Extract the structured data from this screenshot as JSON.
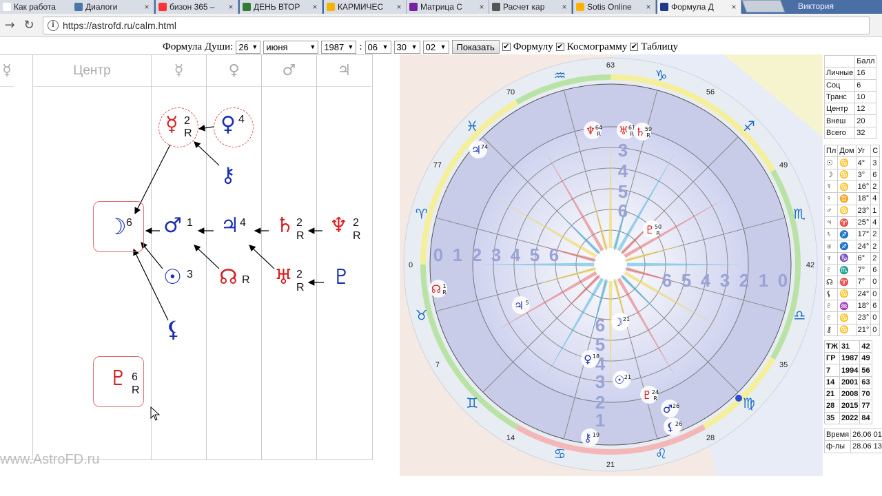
{
  "browser": {
    "tabs": [
      {
        "label": "Как работа",
        "icon": "page-icon",
        "color": "#ffffff"
      },
      {
        "label": "Диалоги",
        "icon": "vk-icon",
        "color": "#4a76a8"
      },
      {
        "label": "бизон 365 –",
        "icon": "yandex-icon",
        "color": "#ff3333"
      },
      {
        "label": "ДЕНЬ ВТОР",
        "icon": "ring-icon",
        "color": "#2e7d32"
      },
      {
        "label": "КАРМИЧЕС",
        "icon": "drive-icon",
        "color": "#f4b400"
      },
      {
        "label": "Матрица С",
        "icon": "gear-icon",
        "color": "#7b1fa2"
      },
      {
        "label": "Расчет кар",
        "icon": "search-icon",
        "color": "#555555"
      },
      {
        "label": "Sotis Online",
        "icon": "sotis-icon",
        "color": "#ffb300"
      },
      {
        "label": "Формула Д",
        "icon": "astro-icon",
        "color": "#1e3a8a"
      }
    ],
    "user": "Виктория",
    "url": "https://astrofd.ru/calm.html"
  },
  "form": {
    "label": "Формула Души:",
    "day": "26",
    "month": "июня",
    "year": "1987",
    "hour": "06",
    "minute": "30",
    "tz": "02",
    "colon": ":",
    "show_button": "Показать",
    "opt_formula": "Формулу",
    "opt_cosmo": "Космограмму",
    "opt_table": "Таблицу"
  },
  "diagram": {
    "headers": [
      "☿",
      "Центр",
      "☿",
      "♀",
      "♂",
      "♃"
    ],
    "planets": [
      {
        "glyph": "☿",
        "num": "2",
        "r": "R"
      },
      {
        "glyph": "♀",
        "num": "4",
        "r": ""
      },
      {
        "glyph": "⚷",
        "num": "",
        "r": ""
      },
      {
        "glyph": "☽",
        "num": "6",
        "r": ""
      },
      {
        "glyph": "♂",
        "num": "1",
        "r": ""
      },
      {
        "glyph": "♃",
        "num": "4",
        "r": ""
      },
      {
        "glyph": "♄",
        "num": "2",
        "r": "R"
      },
      {
        "glyph": "♆",
        "num": "2",
        "r": "R"
      },
      {
        "glyph": "☉",
        "num": "3",
        "r": ""
      },
      {
        "glyph": "☊",
        "num": "",
        "r": "R"
      },
      {
        "glyph": "♅",
        "num": "2",
        "r": "R"
      },
      {
        "glyph": "♇",
        "num": "",
        "r": ""
      },
      {
        "glyph": "⚸",
        "num": "",
        "r": ""
      },
      {
        "glyph": "♇",
        "num": "6",
        "r": "R"
      }
    ],
    "watermark": "www.AstroFD.ru"
  },
  "chart_labels": {
    "outer": [
      "63",
      "56",
      "49",
      "42",
      "35",
      "28",
      "21",
      "14",
      "7",
      "0",
      "77",
      "70"
    ],
    "signs": [
      "♑",
      "♐",
      "♏",
      "♎",
      "♍",
      "♌",
      "♋",
      "♊",
      "♉",
      "♈",
      "♓",
      "♒"
    ],
    "left_ring": [
      "0",
      "1",
      "2",
      "3",
      "4",
      "5",
      "6"
    ],
    "right_ring": [
      "6",
      "5",
      "4",
      "3",
      "2",
      "1",
      "0"
    ],
    "top_ring": [
      "3",
      "4",
      "5",
      "6"
    ],
    "bottom_ring": [
      "6",
      "5",
      "4",
      "3",
      "2",
      "1"
    ],
    "markers": [
      {
        "g": "♆",
        "n": "64",
        "r": "R"
      },
      {
        "g": "♅",
        "n": "61",
        "r": "R"
      },
      {
        "g": "♄",
        "n": "59",
        "r": "R"
      },
      {
        "g": "♃",
        "n": "74",
        "r": ""
      },
      {
        "g": "♇",
        "n": "50",
        "r": "R"
      },
      {
        "g": "☊",
        "n": "1",
        "r": "R"
      },
      {
        "g": "♃",
        "n": "5",
        "r": ""
      },
      {
        "g": "☽",
        "n": "21",
        "r": ""
      },
      {
        "g": "♀",
        "n": "18",
        "r": ""
      },
      {
        "g": "☉",
        "n": "21",
        "r": ""
      },
      {
        "g": "♇",
        "n": "24",
        "r": "R"
      },
      {
        "g": "♂",
        "n": "26",
        "r": ""
      },
      {
        "g": "⚸",
        "n": "26",
        "r": ""
      },
      {
        "g": "⚷",
        "n": "19",
        "r": ""
      }
    ],
    "colors": {
      "blue": "#1a2fb4",
      "red": "#d61f1f",
      "ring": "#c8cce8"
    }
  },
  "scores": {
    "header": "Балл",
    "rows": [
      {
        "label": "Личные",
        "value": "16"
      },
      {
        "label": "Соц",
        "value": "6"
      },
      {
        "label": "Транс",
        "value": "10"
      },
      {
        "label": "Центр",
        "value": "12"
      },
      {
        "label": "Внеш",
        "value": "20"
      },
      {
        "label": "Всего",
        "value": "32"
      }
    ]
  },
  "positions": {
    "headers": [
      "Пл",
      "Дом",
      "Уг",
      "С"
    ],
    "rows": [
      {
        "pl": "☉",
        "dom": "♋",
        "deg": "4°",
        "c": "3"
      },
      {
        "pl": "☽",
        "dom": "♋",
        "deg": "3°",
        "c": "6"
      },
      {
        "pl": "☿",
        "dom": "♋",
        "deg": "16°",
        "c": "2"
      },
      {
        "pl": "♀",
        "dom": "♊",
        "deg": "18°",
        "c": "4"
      },
      {
        "pl": "♂",
        "dom": "♋",
        "deg": "23°",
        "c": "1"
      },
      {
        "pl": "♃",
        "dom": "♈",
        "deg": "25°",
        "c": "4"
      },
      {
        "pl": "♄",
        "dom": "♐",
        "deg": "17°",
        "c": "2"
      },
      {
        "pl": "♅",
        "dom": "♐",
        "deg": "24°",
        "c": "2"
      },
      {
        "pl": "♆",
        "dom": "♑",
        "deg": "6°",
        "c": "2"
      },
      {
        "pl": "♇",
        "dom": "♏",
        "deg": "7°",
        "c": "6"
      },
      {
        "pl": "☊",
        "dom": "♈",
        "deg": "7°",
        "c": "0"
      },
      {
        "pl": "⚸",
        "dom": "♋",
        "deg": "24°",
        "c": "0"
      },
      {
        "pl": "♇",
        "dom": "♒",
        "deg": "18°",
        "c": "6"
      },
      {
        "pl": "♇",
        "dom": "♋",
        "deg": "23°",
        "c": "0"
      },
      {
        "pl": "⚷",
        "dom": "♋",
        "deg": "21°",
        "c": "0"
      }
    ]
  },
  "ages": {
    "rows": [
      {
        "a": "ТЖ",
        "b": "31",
        "c": "42"
      },
      {
        "a": "ГР",
        "b": "1987",
        "c": "49"
      },
      {
        "a": "7",
        "b": "1994",
        "c": "56"
      },
      {
        "a": "14",
        "b": "2001",
        "c": "63"
      },
      {
        "a": "21",
        "b": "2008",
        "c": "70"
      },
      {
        "a": "28",
        "b": "2015",
        "c": "77"
      },
      {
        "a": "35",
        "b": "2022",
        "c": "84"
      }
    ]
  },
  "times": {
    "rows": [
      {
        "label": "Время",
        "value": "26.06 01:"
      },
      {
        "label": "ф-лы",
        "value": "28.06 13:"
      }
    ]
  }
}
